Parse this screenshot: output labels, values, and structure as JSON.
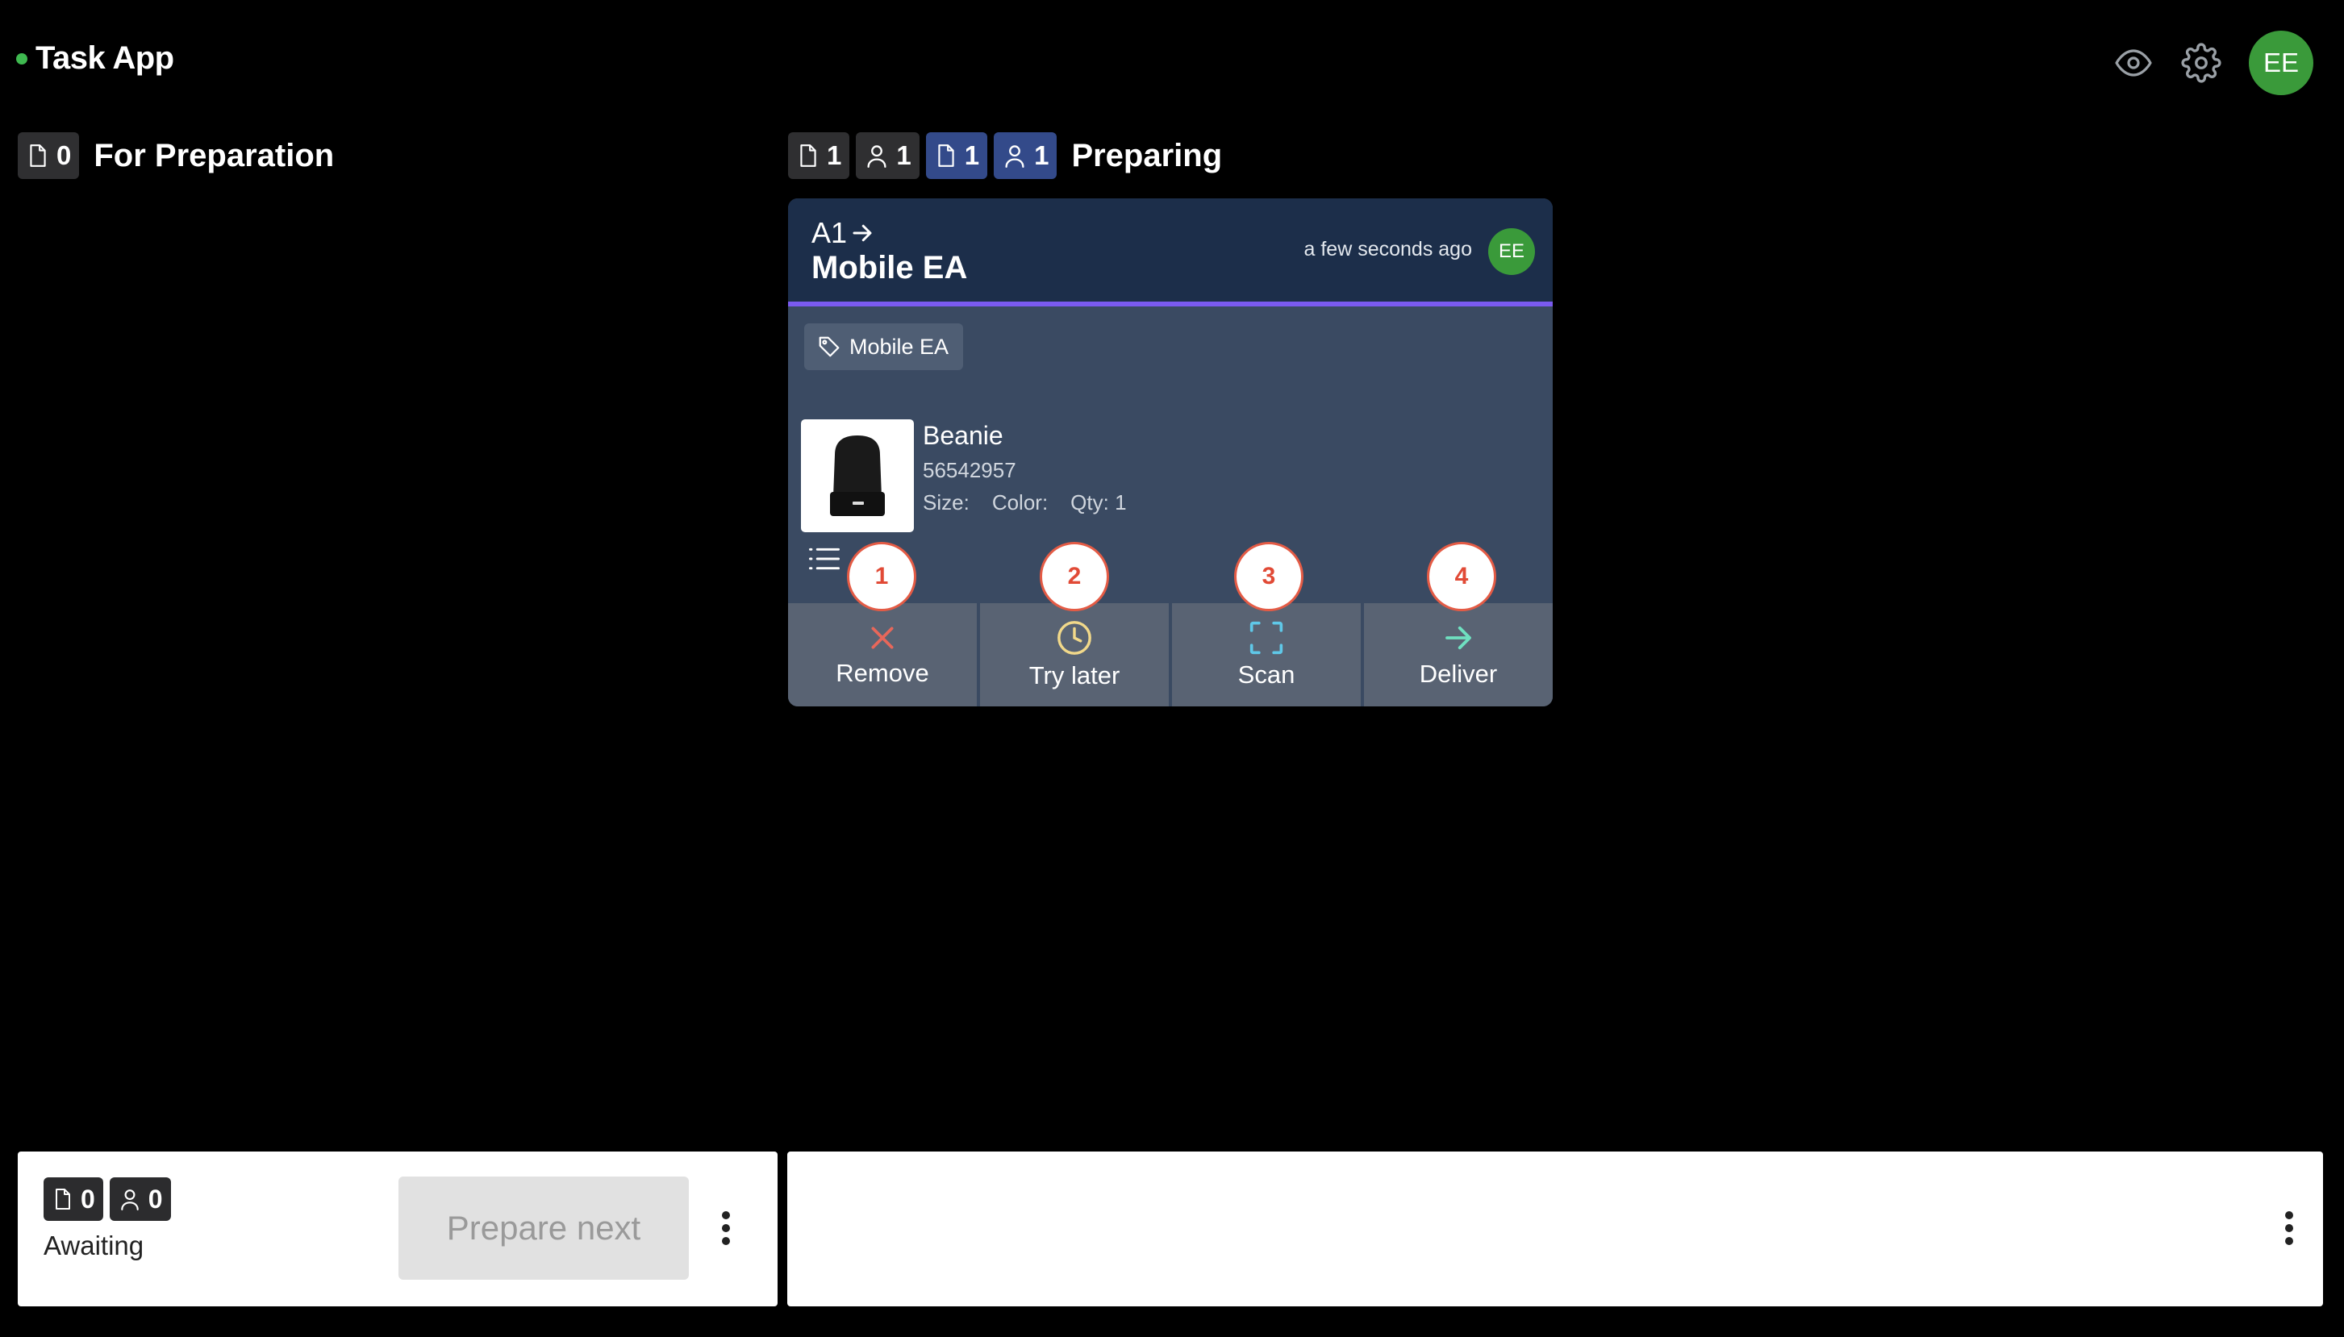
{
  "app": {
    "title": "Task App"
  },
  "header": {
    "user_initials": "EE"
  },
  "columns": [
    {
      "count": "0",
      "title": "For Preparation"
    },
    {
      "counts": [
        "1",
        "1",
        "1",
        "1"
      ],
      "title": "Preparing"
    }
  ],
  "card": {
    "code": "A1",
    "name": "Mobile EA",
    "timestamp": "a few seconds ago",
    "assignee_initials": "EE",
    "tag": "Mobile EA",
    "item": {
      "name": "Beanie",
      "sku": "56542957",
      "size_label": "Size:",
      "color_label": "Color:",
      "qty_label": "Qty: 1"
    },
    "actions": [
      {
        "label": "Remove",
        "marker": "1",
        "icon": "close-icon",
        "color": "#e8675a"
      },
      {
        "label": "Try later",
        "marker": "2",
        "icon": "clock-icon",
        "color": "#f2d98a"
      },
      {
        "label": "Scan",
        "marker": "3",
        "icon": "scan-icon",
        "color": "#5fc8e8"
      },
      {
        "label": "Deliver",
        "marker": "4",
        "icon": "arrow-right-icon",
        "color": "#6fe0c0"
      }
    ]
  },
  "bottom": {
    "docs_count": "0",
    "users_count": "0",
    "status": "Awaiting",
    "prepare_next": "Prepare next"
  }
}
